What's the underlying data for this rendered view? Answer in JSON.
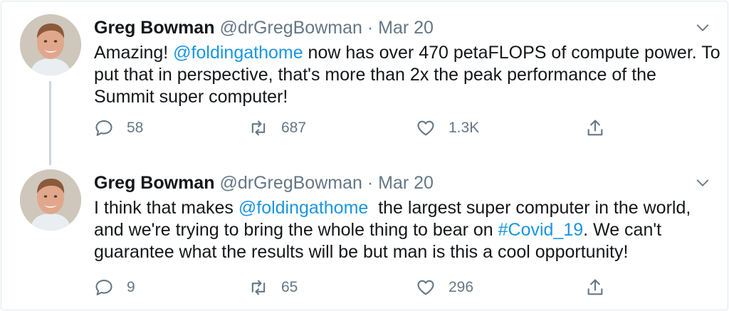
{
  "tweets": [
    {
      "name": "Greg Bowman",
      "handle": "@drGregBowman",
      "separator": "·",
      "date": "Mar 20",
      "text": {
        "part1": "Amazing! ",
        "mention": "@foldingathome",
        "part2": " now has over 470 petaFLOPS of compute power. To put that in perspective, that's more than 2x the peak performance of the Summit super computer!"
      },
      "replies": "58",
      "retweets": "687",
      "likes": "1.3K"
    },
    {
      "name": "Greg Bowman",
      "handle": "@drGregBowman",
      "separator": "·",
      "date": "Mar 20",
      "text": {
        "part1": "I think that makes ",
        "mention": "@foldingathome",
        "part2": "  the largest super computer in the world, and we're trying to bring the whole thing to bear on ",
        "hashtag": "#Covid_19",
        "part3": ". We can't guarantee what the results will be but man is this a cool opportunity!"
      },
      "replies": "9",
      "retweets": "65",
      "likes": "296"
    }
  ],
  "icons": {
    "reply": "speech-bubble",
    "retweet": "retweet-arrows",
    "like": "heart",
    "share": "upload-arrow",
    "menu": "chevron-down"
  },
  "colors": {
    "link": "#1b95e0",
    "secondary_text": "#657786",
    "thread_line": "#ccd6dd"
  }
}
